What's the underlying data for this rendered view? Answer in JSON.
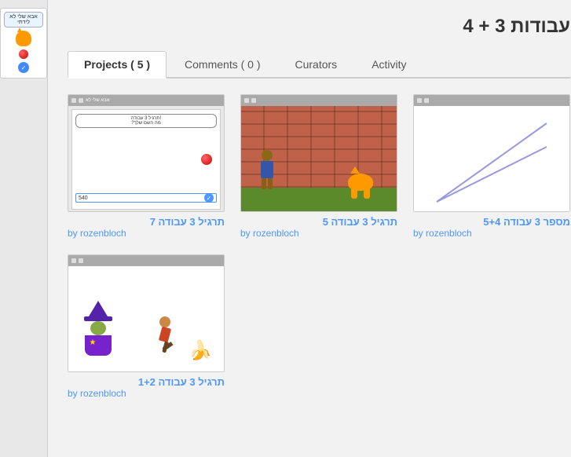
{
  "page": {
    "title": "עבודות 3 + 4"
  },
  "tabs": [
    {
      "id": "projects",
      "label": "Projects ( 5 )",
      "active": true
    },
    {
      "id": "comments",
      "label": "Comments ( 0 )",
      "active": false
    },
    {
      "id": "curators",
      "label": "Curators",
      "active": false
    },
    {
      "id": "activity",
      "label": "Activity",
      "active": false
    }
  ],
  "projects": [
    {
      "id": 1,
      "title": "תרגיל 3 עבודה 7",
      "author": "rozenbloch",
      "type": "scratch-blocks"
    },
    {
      "id": 2,
      "title": "תרגיל 3 עבודה 5",
      "author": "rozenbloch",
      "type": "photo"
    },
    {
      "id": 3,
      "title": "מספר 3 עבודה 5+4",
      "author": "rozenbloch",
      "type": "graph"
    },
    {
      "id": 4,
      "title": "תרגיל 3 עבודה 1+2",
      "author": "rozenbloch",
      "type": "characters"
    }
  ],
  "labels": {
    "by": "by",
    "scratch_input_value": "540",
    "scratch_bubble_text": "!תרגיל 3 עבודה",
    "scratch_bubble_text2": "מה השם שלך?"
  },
  "colors": {
    "accent": "#4d97ff",
    "tab_active_bg": "#ffffff",
    "title_color": "#333333"
  }
}
